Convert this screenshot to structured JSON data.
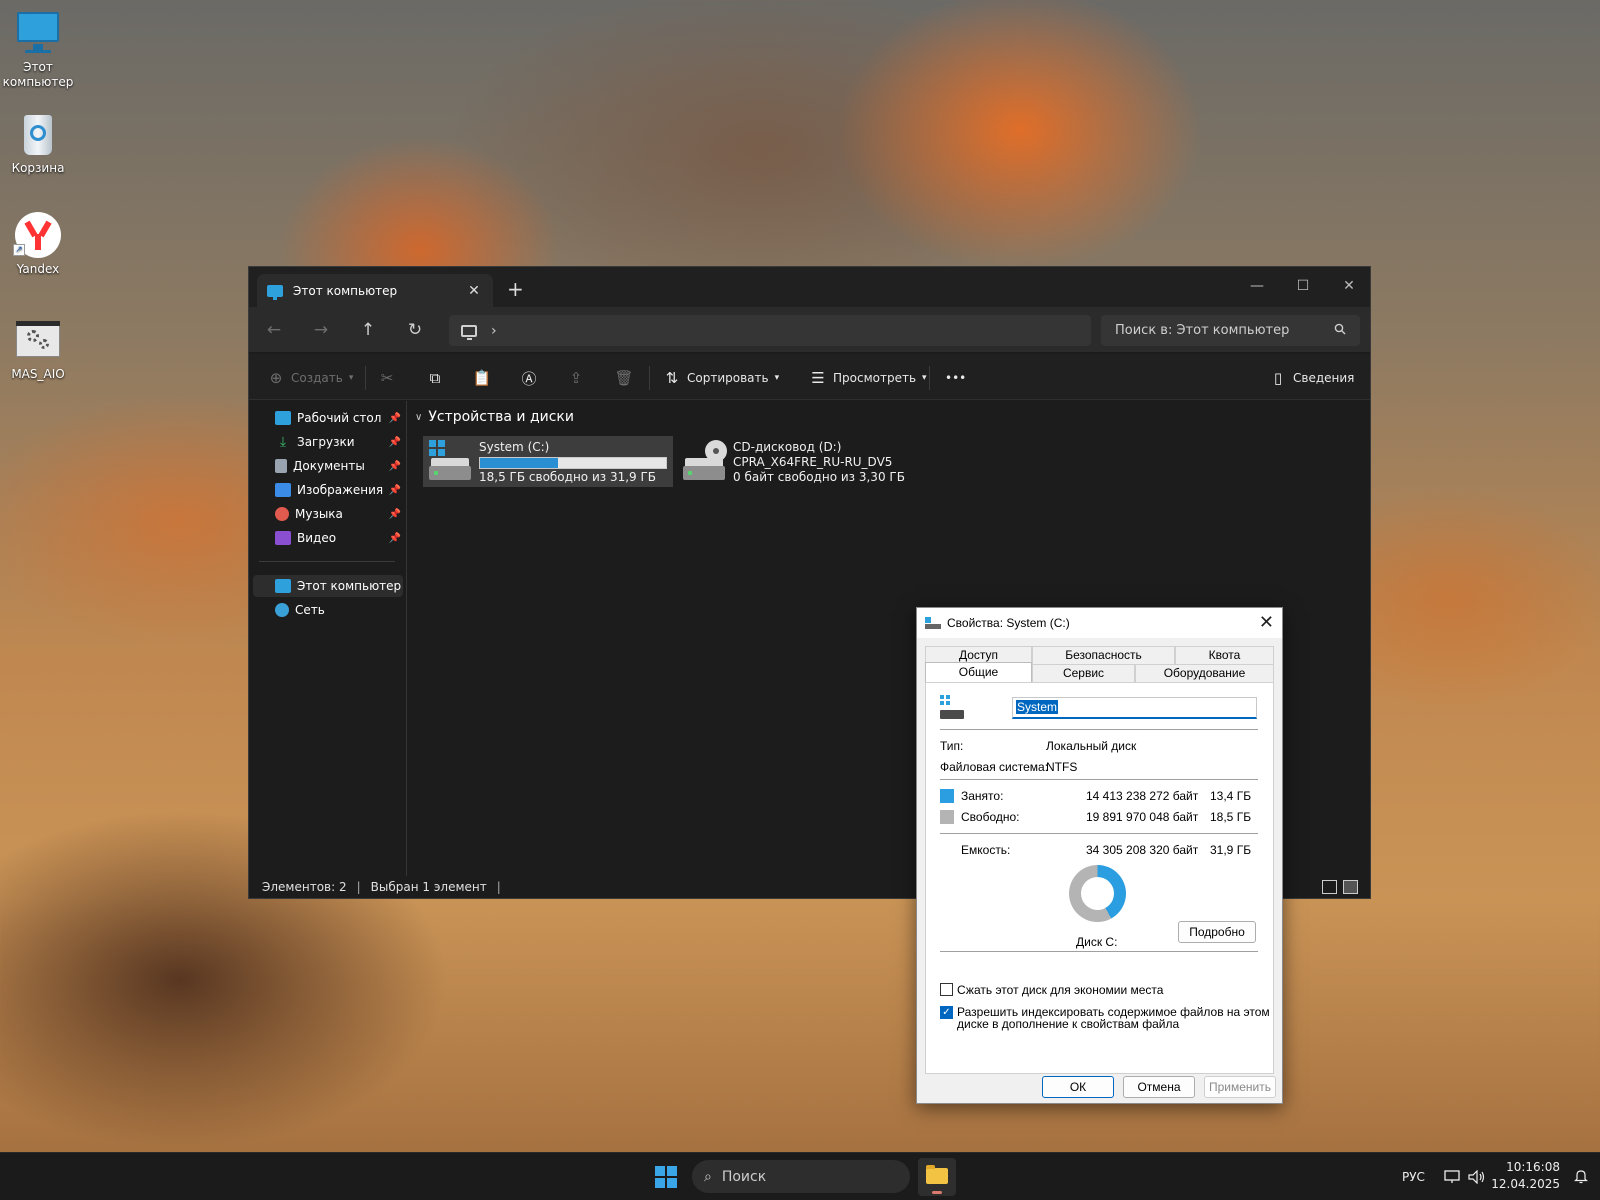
{
  "desktop": {
    "icons": [
      {
        "label": "Этот компьютер"
      },
      {
        "label": "Корзина"
      },
      {
        "label": "Yandex"
      },
      {
        "label": "MAS_AIO"
      }
    ]
  },
  "explorer": {
    "tab_title": "Этот компьютер",
    "tab_close": "✕",
    "new_tab": "+",
    "window_controls": {
      "minimize": "—",
      "maximize": "☐",
      "close": "✕"
    },
    "nav": {
      "back": "←",
      "forward": "→",
      "up": "↑",
      "refresh": "↻"
    },
    "address_chevron": "›",
    "search_placeholder": "Поиск в: Этот компьютер",
    "toolbar": {
      "create": "Создать",
      "sort": "Сортировать",
      "view": "Просмотреть",
      "more": "•••",
      "details": "Сведения"
    },
    "sidebar": {
      "quick": [
        {
          "label": "Рабочий стол",
          "color": "#2ea1dd"
        },
        {
          "label": "Загрузки",
          "color": "#38b56a"
        },
        {
          "label": "Документы",
          "color": "#9aa4b1"
        },
        {
          "label": "Изображения",
          "color": "#3b8ce6"
        },
        {
          "label": "Музыка",
          "color": "#e05a4e"
        },
        {
          "label": "Видео",
          "color": "#8a4fd1"
        }
      ],
      "pin": "📌",
      "this_pc": "Этот компьютер",
      "network": "Сеть"
    },
    "group_title": "Устройства и диски",
    "group_chevron": "∨",
    "drives": [
      {
        "name": "System (C:)",
        "free": "18,5 ГБ свободно из 31,9 ГБ",
        "used_fraction": 0.42
      },
      {
        "name": "CD-дисковод (D:)",
        "label": "CPRA_X64FRE_RU-RU_DV5",
        "free": "0 байт свободно из 3,30 ГБ"
      }
    ],
    "status": {
      "count": "Элементов: 2",
      "selected": "Выбран 1 элемент"
    }
  },
  "dialog": {
    "title": "Свойства: System (C:)",
    "close": "✕",
    "tabs_top": [
      "Доступ",
      "Безопасность",
      "Квота"
    ],
    "tabs_bottom": [
      "Общие",
      "Сервис",
      "Оборудование"
    ],
    "name_value": "System",
    "type_label": "Тип:",
    "type_value": "Локальный диск",
    "fs_label": "Файловая система:",
    "fs_value": "NTFS",
    "used_label": "Занято:",
    "used_bytes": "14 413 238 272 байт",
    "used_gb": "13,4 ГБ",
    "free_label": "Свободно:",
    "free_bytes": "19 891 970 048 байт",
    "free_gb": "18,5 ГБ",
    "capacity_label": "Емкость:",
    "capacity_bytes": "34 305 208 320 байт",
    "capacity_gb": "31,9 ГБ",
    "used_fraction": 0.42,
    "used_color": "#2a9ee0",
    "free_color": "#b4b4b4",
    "disk_label": "Диск C:",
    "details_button": "Подробно",
    "compress_label": "Сжать этот диск для экономии места",
    "compress_checked": false,
    "index_label_line1": "Разрешить индексировать содержимое файлов на этом",
    "index_label_line2": "диске в дополнение к свойствам файла",
    "index_checked": true,
    "ok": "ОК",
    "cancel": "Отмена",
    "apply": "Применить"
  },
  "taskbar": {
    "search": "Поиск",
    "search_icon": "⌕",
    "lang": "РУС",
    "time": "10:16:08",
    "date": "12.04.2025",
    "bell": "🔔"
  }
}
